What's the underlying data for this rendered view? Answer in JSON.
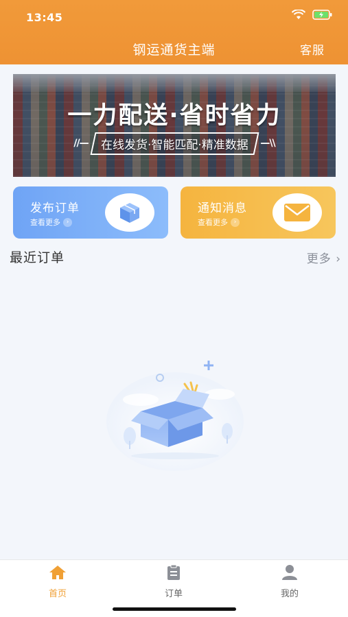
{
  "status_bar": {
    "time": "13:45"
  },
  "header": {
    "title": "钢运通货主端",
    "action": "客服"
  },
  "banner": {
    "title": "一力配送·省时省力",
    "subtitle": "在线发货·智能匹配·精准数据",
    "left_deco": "//—",
    "right_deco": "—\\\\"
  },
  "cards": [
    {
      "title": "发布订单",
      "sub": "查看更多",
      "icon": "box-icon",
      "color": "#6fa4f5"
    },
    {
      "title": "通知消息",
      "sub": "查看更多",
      "icon": "envelope-icon",
      "color": "#f5b43f"
    }
  ],
  "section": {
    "title": "最近订单",
    "more": "更多 ›"
  },
  "empty_state": {
    "icon": "empty-box-illustration"
  },
  "tabbar": {
    "items": [
      {
        "label": "首页",
        "icon": "home-icon",
        "active": true
      },
      {
        "label": "订单",
        "icon": "clipboard-icon",
        "active": false
      },
      {
        "label": "我的",
        "icon": "user-icon",
        "active": false
      }
    ],
    "active_color": "#f0a035"
  },
  "colors": {
    "brand": "#f19a3a",
    "background": "#f3f6fb"
  }
}
